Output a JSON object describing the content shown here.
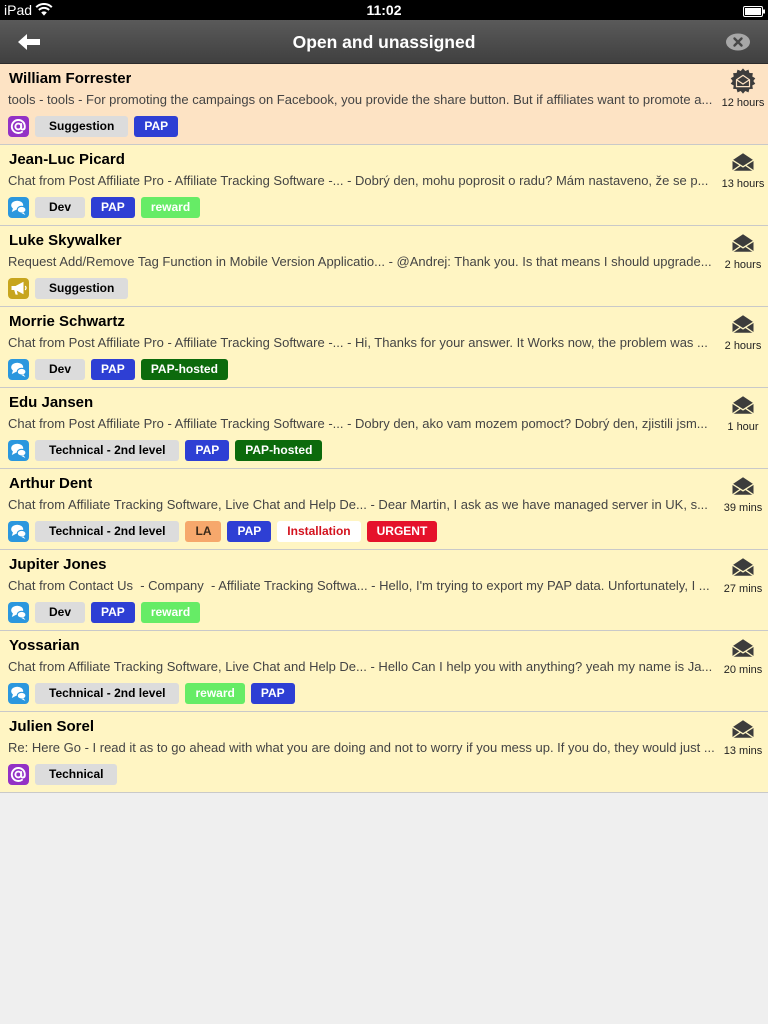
{
  "status_bar": {
    "carrier": "iPad",
    "time": "11:02",
    "wifi_icon": "wifi-icon",
    "battery_icon": "battery-icon"
  },
  "nav": {
    "title": "Open and unassigned",
    "back_icon": "back-arrow-icon",
    "close_icon": "close-icon"
  },
  "colors": {
    "status_bar_background": "#000000",
    "nav_background": "#474747",
    "row_background": "#fff5c3",
    "row_highlight_background": "#fde3c4",
    "row_separator": "#c9c9c9",
    "list_background": "#efefef",
    "department_tag_background": "#dcdcdc",
    "department_tag_text": "#000000",
    "status_icon": "#3c3c3c"
  },
  "tickets": [
    {
      "name": "William Forrester",
      "subject": "tools - tools - For promoting the campaings on Facebook, you provide the share button. But if affiliates want to promote a...",
      "channel_icon": "email-icon",
      "status_icon": "new-mail-icon",
      "age": "12 hours",
      "highlighted": true,
      "department": "Suggestion",
      "tags": [
        {
          "label": "PAP",
          "background": "#2e3fd4",
          "text_color": "#ffffff"
        }
      ]
    },
    {
      "name": "Jean-Luc Picard",
      "subject": "Chat from Post Affiliate Pro - Affiliate Tracking Software -... - Dobrý den, mohu poprosit o radu? Mám nastaveno, že se p...",
      "channel_icon": "chat-icon",
      "status_icon": "mail-icon",
      "age": "13 hours",
      "highlighted": false,
      "department": "Dev",
      "tags": [
        {
          "label": "PAP",
          "background": "#2e3fd4",
          "text_color": "#ffffff"
        },
        {
          "label": "reward",
          "background": "#66ec66",
          "text_color": "#ffffff"
        }
      ]
    },
    {
      "name": "Luke Skywalker",
      "subject": "Request Add/Remove Tag Function in Mobile Version Applicatio... - @Andrej: Thank you. Is that means I should upgrade...",
      "channel_icon": "megaphone-icon",
      "status_icon": "mail-icon",
      "age": "2 hours",
      "highlighted": false,
      "department": "Suggestion",
      "tags": []
    },
    {
      "name": "Morrie Schwartz",
      "subject": "Chat from Post Affiliate Pro - Affiliate Tracking Software -... - Hi, Thanks for your answer. It Works now, the problem was ...",
      "channel_icon": "chat-icon",
      "status_icon": "mail-icon",
      "age": "2 hours",
      "highlighted": false,
      "department": "Dev",
      "tags": [
        {
          "label": "PAP",
          "background": "#2e3fd4",
          "text_color": "#ffffff"
        },
        {
          "label": "PAP-hosted",
          "background": "#0c6a0c",
          "text_color": "#ffffff"
        }
      ]
    },
    {
      "name": "Edu Jansen",
      "subject": "Chat from Post Affiliate Pro - Affiliate Tracking Software -... - Dobry den, ako vam mozem pomoct? Dobrý den, zjistili jsm...",
      "channel_icon": "chat-icon",
      "status_icon": "mail-icon",
      "age": "1 hour",
      "highlighted": false,
      "department": "Technical - 2nd level",
      "tags": [
        {
          "label": "PAP",
          "background": "#2e3fd4",
          "text_color": "#ffffff"
        },
        {
          "label": "PAP-hosted",
          "background": "#0c6a0c",
          "text_color": "#ffffff"
        }
      ]
    },
    {
      "name": "Arthur Dent",
      "subject": "Chat from Affiliate Tracking Software, Live Chat and Help De... - Dear Martin, I ask as we have managed server in UK, s...",
      "channel_icon": "chat-icon",
      "status_icon": "mail-icon",
      "age": "39 mins",
      "highlighted": false,
      "department": "Technical - 2nd level",
      "tags": [
        {
          "label": "LA",
          "background": "#f6a86c",
          "text_color": "#3a2a1a"
        },
        {
          "label": "PAP",
          "background": "#2e3fd4",
          "text_color": "#ffffff"
        },
        {
          "label": "Installation",
          "background": "#ffffff",
          "text_color": "#d3121e"
        },
        {
          "label": "URGENT",
          "background": "#e5122b",
          "text_color": "#ffffff"
        }
      ]
    },
    {
      "name": "Jupiter Jones",
      "subject": "Chat from Contact Us  - Company  - Affiliate Tracking Softwa... - Hello, I'm trying to export my PAP data. Unfortunately, I ...",
      "channel_icon": "chat-icon",
      "status_icon": "mail-icon",
      "age": "27 mins",
      "highlighted": false,
      "department": "Dev",
      "tags": [
        {
          "label": "PAP",
          "background": "#2e3fd4",
          "text_color": "#ffffff"
        },
        {
          "label": "reward",
          "background": "#66ec66",
          "text_color": "#ffffff"
        }
      ]
    },
    {
      "name": "Yossarian",
      "subject": "Chat from Affiliate Tracking Software, Live Chat and Help De... - Hello Can I help you with anything? yeah my name is Ja...",
      "channel_icon": "chat-icon",
      "status_icon": "mail-icon",
      "age": "20 mins",
      "highlighted": false,
      "department": "Technical - 2nd level",
      "tags": [
        {
          "label": "reward",
          "background": "#66ec66",
          "text_color": "#ffffff"
        },
        {
          "label": "PAP",
          "background": "#2e3fd4",
          "text_color": "#ffffff"
        }
      ]
    },
    {
      "name": "Julien Sorel",
      "subject": "Re: Here Go - I read it as to go ahead with what you are doing and not to worry if you mess up. If you do, they would just ...",
      "channel_icon": "email-icon",
      "status_icon": "mail-icon",
      "age": "13 mins",
      "highlighted": false,
      "department": "Technical",
      "tags": []
    }
  ]
}
